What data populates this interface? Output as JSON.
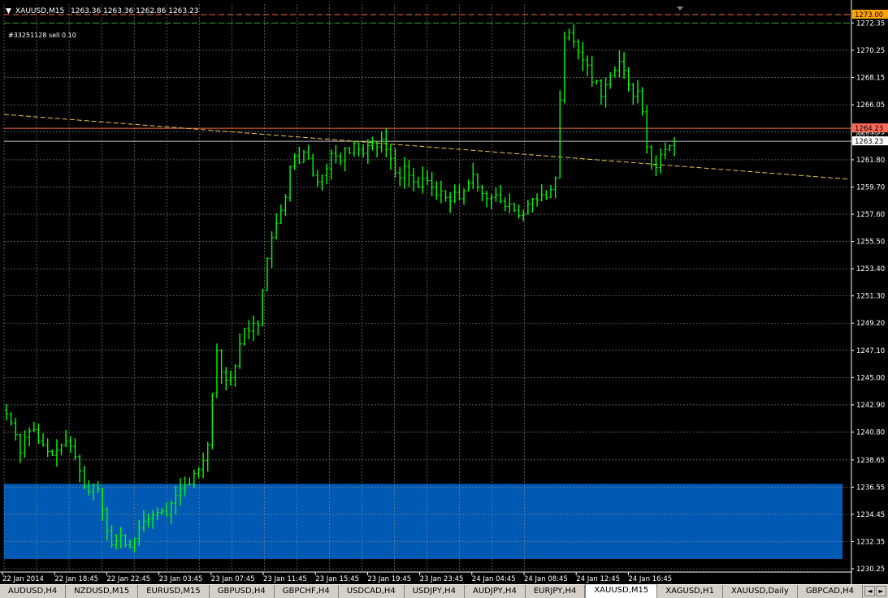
{
  "header": {
    "symbol_label": "XAUUSD,M15",
    "ohlc": "1263.36 1263.36 1262.86 1263.23",
    "order_label": "#33251128 sell 0.10",
    "dropdown_icon": "triangle-down-icon"
  },
  "colors": {
    "background": "#000000",
    "grid": "#8a8a8a",
    "candle": "#00ff00",
    "axis_text": "#ffffff",
    "order_line": "#ff6a3a",
    "tp_line": "#2fa12f",
    "trend_line": "#e8c84a",
    "zone": "#0059b3",
    "bid_line": "#c0c0c0"
  },
  "price_labels": {
    "order": "1273.00",
    "tp": "1272.35",
    "stop": "1264.23",
    "stop_under": "1263.79",
    "bid": "1263.23"
  },
  "chart_data": {
    "type": "candlestick",
    "symbol": "XAUUSD",
    "timeframe": "M15",
    "y_ticks": [
      "1272.35",
      "1270.25",
      "1268.15",
      "1266.05",
      "1263.95",
      "1261.80",
      "1259.70",
      "1257.60",
      "1255.50",
      "1253.40",
      "1251.30",
      "1249.20",
      "1247.10",
      "1245.00",
      "1242.90",
      "1240.80",
      "1238.65",
      "1236.55",
      "1234.45",
      "1232.35",
      "1230.25"
    ],
    "ylim": [
      1230.0,
      1273.5
    ],
    "x_ticks": [
      "22 Jan 2014",
      "22 Jan 18:45",
      "22 Jan 22:45",
      "23 Jan 03:45",
      "23 Jan 07:45",
      "23 Jan 11:45",
      "23 Jan 15:45",
      "23 Jan 19:45",
      "23 Jan 23:45",
      "24 Jan 04:45",
      "24 Jan 08:45",
      "24 Jan 12:45",
      "24 Jan 16:45"
    ],
    "lines": [
      {
        "name": "sell order",
        "price": 1273.0
      },
      {
        "name": "take profit",
        "price": 1272.35
      },
      {
        "name": "stop",
        "price": 1264.23
      },
      {
        "name": "bid",
        "price": 1263.23
      }
    ],
    "trendline": {
      "start": 1265.3,
      "end": 1260.3
    },
    "zone": {
      "top": 1236.8,
      "bottom": 1231.0
    },
    "close_path": [
      1242.2,
      1241.5,
      1240.6,
      1239.2,
      1240.4,
      1240.9,
      1241.0,
      1240.1,
      1239.8,
      1239.3,
      1239.0,
      1239.4,
      1239.8,
      1240.1,
      1239.7,
      1238.9,
      1237.8,
      1236.6,
      1236.2,
      1236.7,
      1236.4,
      1234.8,
      1233.2,
      1232.1,
      1232.4,
      1232.8,
      1232.1,
      1231.9,
      1232.6,
      1233.4,
      1233.9,
      1234.1,
      1234.4,
      1234.6,
      1234.7,
      1234.4,
      1235.3,
      1235.9,
      1236.4,
      1236.7,
      1236.8,
      1237.6,
      1237.9,
      1238.6,
      1239.8,
      1243.8,
      1247.1,
      1245.4,
      1244.8,
      1245.0,
      1245.9,
      1247.6,
      1248.8,
      1248.6,
      1249.2,
      1249.0,
      1251.7,
      1254.2,
      1255.8,
      1256.9,
      1257.9,
      1258.9,
      1261.3,
      1262.1,
      1261.6,
      1262.4,
      1261.9,
      1260.6,
      1260.1,
      1260.6,
      1261.1,
      1262.3,
      1262.1,
      1261.7,
      1262.7,
      1262.3,
      1263.1,
      1262.6,
      1262.3,
      1262.9,
      1263.1,
      1262.8,
      1263.4,
      1262.6,
      1261.9,
      1260.8,
      1260.4,
      1261.3,
      1260.6,
      1260.1,
      1259.7,
      1260.4,
      1260.2,
      1259.7,
      1259.1,
      1259.4,
      1258.9,
      1258.6,
      1259.3,
      1258.8,
      1259.4,
      1260.0,
      1260.7,
      1259.7,
      1259.2,
      1258.8,
      1258.9,
      1259.1,
      1258.6,
      1258.2,
      1258.4,
      1257.9,
      1257.5,
      1257.6,
      1258.4,
      1258.8,
      1258.7,
      1259.1,
      1258.9,
      1259.5,
      1260.4,
      1266.4,
      1271.2,
      1271.6,
      1270.9,
      1270.1,
      1269.5,
      1269.1,
      1267.8,
      1267.9,
      1266.7,
      1267.6,
      1268.3,
      1268.7,
      1269.4,
      1268.7,
      1267.6,
      1266.7,
      1267.1,
      1265.5,
      1262.8,
      1261.4,
      1261.2,
      1262.2,
      1262.6,
      1262.9,
      1263.2
    ]
  },
  "tabs": [
    {
      "label": "AUDUSD,H4",
      "active": false
    },
    {
      "label": "NZDUSD,M15",
      "active": false
    },
    {
      "label": "EURUSD,M15",
      "active": false
    },
    {
      "label": "GBPUSD,H4",
      "active": false
    },
    {
      "label": "GBPCHF,H4",
      "active": false
    },
    {
      "label": "USDCAD,H4",
      "active": false
    },
    {
      "label": "USDJPY,H4",
      "active": false
    },
    {
      "label": "AUDJPY,H4",
      "active": false
    },
    {
      "label": "EURJPY,H4",
      "active": false
    },
    {
      "label": "XAUUSD,M15",
      "active": true
    },
    {
      "label": "XAGUSD,H1",
      "active": false
    },
    {
      "label": "XAUUSD,Daily",
      "active": false
    },
    {
      "label": "GBPCAD,H4",
      "active": false
    }
  ],
  "nav": {
    "prev_icon": "chevron-left-icon",
    "next_icon": "chevron-right-icon",
    "prev": "◄",
    "next": "►"
  }
}
